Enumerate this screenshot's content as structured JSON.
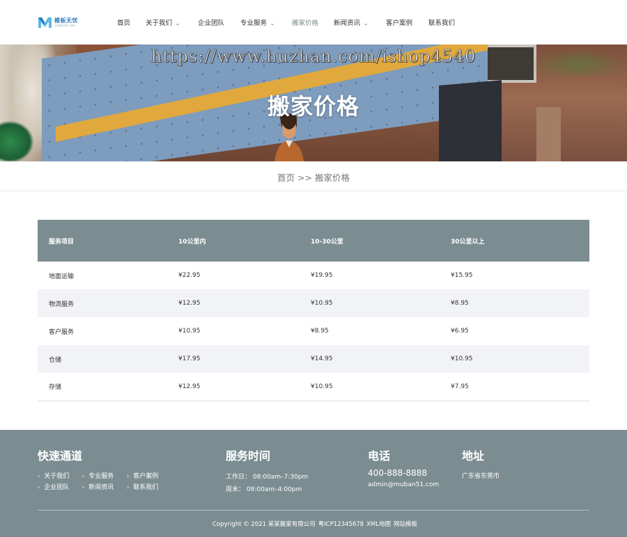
{
  "brand": {
    "logo_text": "模板无忧",
    "logo_sub": "muban51.com",
    "accent_color": "#7b8d91"
  },
  "nav": {
    "items": [
      {
        "label": "首页",
        "has_dropdown": false,
        "active": false
      },
      {
        "label": "关于我们",
        "has_dropdown": true,
        "active": false
      },
      {
        "label": "企业团队",
        "has_dropdown": false,
        "active": false
      },
      {
        "label": "专业服务",
        "has_dropdown": true,
        "active": false
      },
      {
        "label": "搬家价格",
        "has_dropdown": false,
        "active": true
      },
      {
        "label": "新闻资讯",
        "has_dropdown": true,
        "active": false
      },
      {
        "label": "客户案例",
        "has_dropdown": false,
        "active": false
      },
      {
        "label": "联系我们",
        "has_dropdown": false,
        "active": false
      }
    ],
    "chevron_glyph": "⌄"
  },
  "banner": {
    "watermark": "https://www.huzhan.com/ishop4540",
    "title": "搬家价格"
  },
  "breadcrumb": {
    "home": "首页",
    "separator": ">>",
    "current": "搬家价格"
  },
  "price_table": {
    "headers": [
      "服务项目",
      "10公里内",
      "10-30公里",
      "30公里以上"
    ],
    "rows": [
      [
        "地面运输",
        "¥22.95",
        "¥19.95",
        "¥15.95"
      ],
      [
        "物流服务",
        "¥12.95",
        "¥10.95",
        "¥8.95"
      ],
      [
        "客户服务",
        "¥10.95",
        "¥8.95",
        "¥6.95"
      ],
      [
        "仓储",
        "¥17.95",
        "¥14.95",
        "¥10.95"
      ],
      [
        "存储",
        "¥12.95",
        "¥10.95",
        "¥7.95"
      ]
    ]
  },
  "footer": {
    "quick": {
      "title": "快速通道",
      "links": [
        "关于我们",
        "专业服务",
        "客户案例",
        "企业团队",
        "新闻资讯",
        "联系我们"
      ]
    },
    "hours": {
      "title": "服务时间",
      "weekday": "工作日： 08:00am–7:30pm",
      "weekend": "周末： 08:00am–4:00pm"
    },
    "phone": {
      "title": "电话",
      "number": "400-888-8888",
      "email": "admin@muban51.com"
    },
    "address": {
      "title": "地址",
      "text": "广东省东莞市"
    },
    "copyright": {
      "text": "Copyright © 2021 某某搬家有限公司",
      "icp": "粤ICP12345678",
      "sitemap": "XML地图",
      "template": "网站模板"
    }
  }
}
